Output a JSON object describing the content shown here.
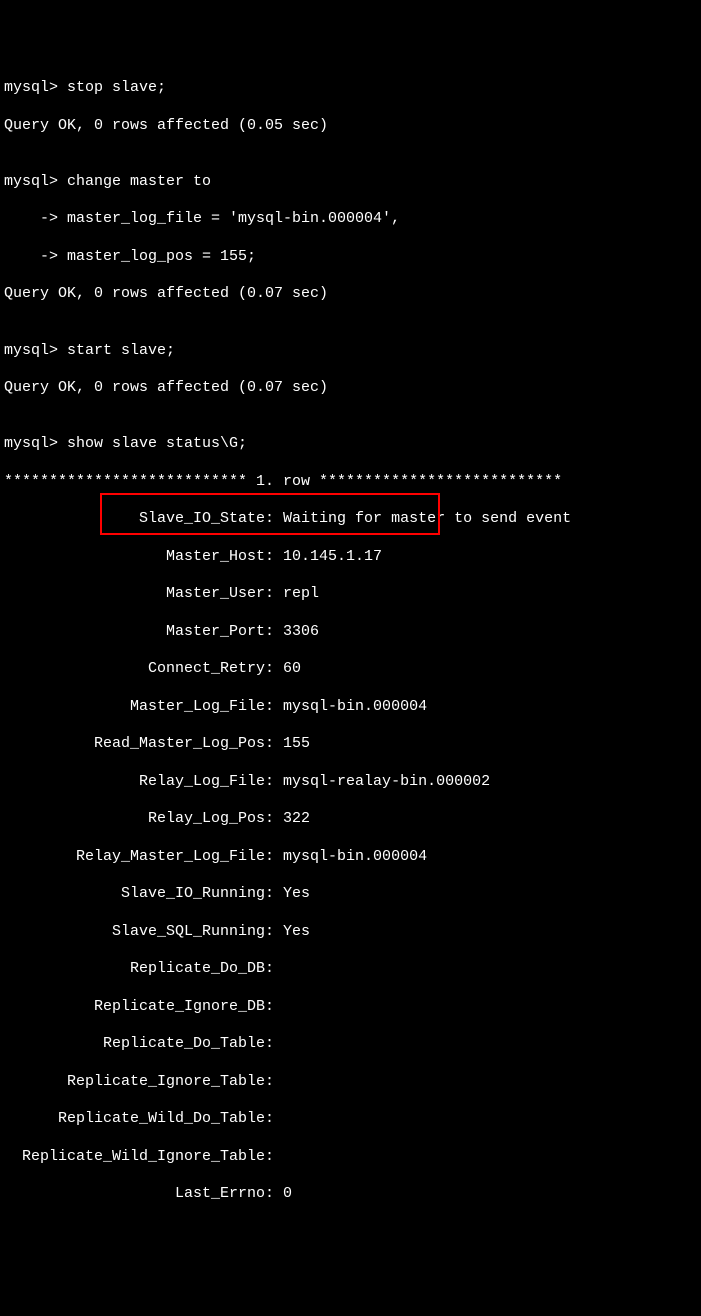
{
  "lines": {
    "l1": "mysql> stop slave;",
    "l2": "Query OK, 0 rows affected (0.05 sec)",
    "l3": "",
    "l4": "mysql> change master to",
    "l5": "    -> master_log_file = 'mysql-bin.000004',",
    "l6": "    -> master_log_pos = 155;",
    "l7": "Query OK, 0 rows affected (0.07 sec)",
    "l8": "",
    "l9": "mysql> start slave;",
    "l10": "Query OK, 0 rows affected (0.07 sec)",
    "l11": "",
    "l12": "mysql> show slave status\\G;",
    "l13": "*************************** 1. row ***************************",
    "l14": "               Slave_IO_State: Waiting for master to send event",
    "l15": "                  Master_Host: 10.145.1.17",
    "l16": "                  Master_User: repl",
    "l17": "                  Master_Port: 3306",
    "l18": "                Connect_Retry: 60",
    "l19": "              Master_Log_File: mysql-bin.000004",
    "l20": "          Read_Master_Log_Pos: 155",
    "l21": "               Relay_Log_File: mysql-realay-bin.000002",
    "l22": "                Relay_Log_Pos: 322",
    "l23": "        Relay_Master_Log_File: mysql-bin.000004",
    "l24": "             Slave_IO_Running: Yes",
    "l25": "            Slave_SQL_Running: Yes",
    "l26": "              Replicate_Do_DB:",
    "l27": "          Replicate_Ignore_DB:",
    "l28": "           Replicate_Do_Table:",
    "l29": "       Replicate_Ignore_Table:",
    "l30": "      Replicate_Wild_Do_Table:",
    "l31": "  Replicate_Wild_Ignore_Table:",
    "l32": "                   Last_Errno: 0"
  }
}
